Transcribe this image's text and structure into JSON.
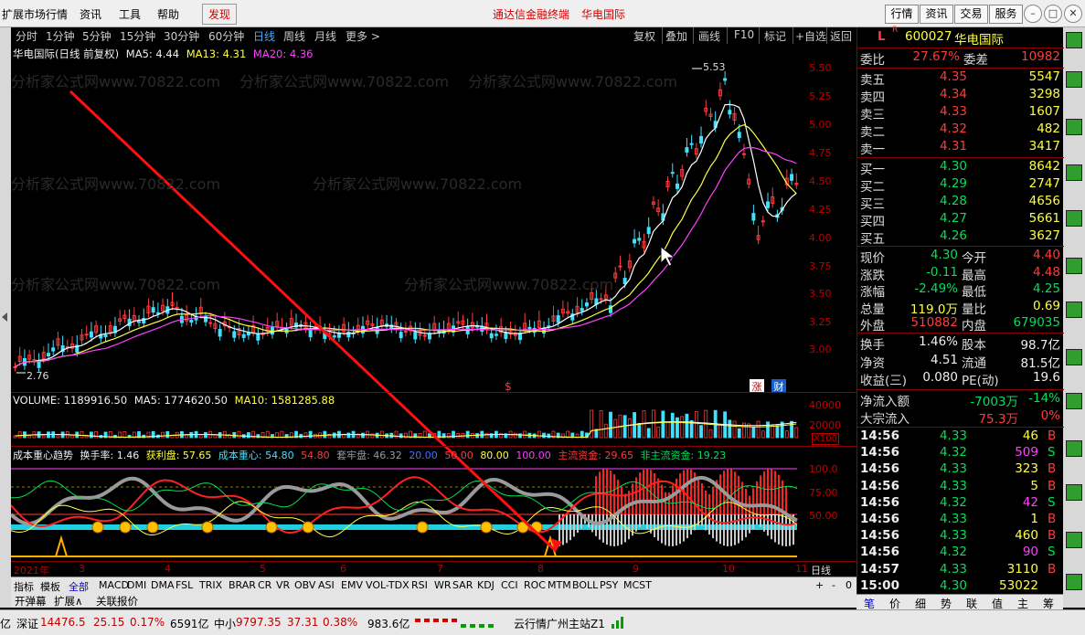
{
  "menu": {
    "items": [
      "扩展市场行情",
      "资讯",
      "工具",
      "帮助",
      "发现"
    ],
    "promo1": "通达信金融终端",
    "promo2": "华电国际",
    "tabs": [
      "行情",
      "资讯",
      "交易",
      "服务"
    ]
  },
  "periods": {
    "items": [
      "分时",
      "1分钟",
      "5分钟",
      "15分钟",
      "30分钟",
      "60分钟",
      "日线",
      "周线",
      "月线",
      "更多 >"
    ],
    "active": "日线",
    "tools": [
      "复权",
      "叠加",
      "画线",
      "F10",
      "标记",
      "+自选",
      "返回"
    ]
  },
  "main_chart": {
    "legend_title": "华电国际(日线 前复权)",
    "ma5": "MA5: 4.44",
    "ma13": "MA13: 4.31",
    "ma20": "MA20: 4.36",
    "high_label": "5.53",
    "low_label": "2.76",
    "watermark": "分析家公式网www.70822.com",
    "y_ticks": [
      "5.50",
      "5.25",
      "5.00",
      "4.75",
      "4.50",
      "4.25",
      "4.00",
      "3.75",
      "3.50",
      "3.25",
      "3.00"
    ],
    "badge_zhang": "涨",
    "badge_cai": "财",
    "dollar": "$"
  },
  "volume": {
    "label": "VOLUME: 1189916.50",
    "ma5": "MA5: 1774620.50",
    "ma10": "MA10: 1581285.88",
    "y_ticks": [
      "40000",
      "20000"
    ],
    "unit": "X100"
  },
  "indicator": {
    "title": "成本重心趋势",
    "turnover": "换手率: 1.46",
    "profit": "获利盘: 57.65",
    "center": "成本重心: 54.80",
    "v1": "54.80",
    "trap": "套牢盘: 46.32",
    "lv20": "20.00",
    "lv50": "50.00",
    "lv80": "80.00",
    "lv100": "100.00",
    "main_fund": "主流资金: 29.65",
    "non_main": "非主流资金: 19.23",
    "y_ticks": [
      "100.0",
      "75.00",
      "50.00"
    ]
  },
  "x_axis": {
    "labels": [
      "2021年",
      "3",
      "4",
      "5",
      "6",
      "7",
      "8",
      "9",
      "10",
      "11"
    ],
    "period_label": "日线"
  },
  "indicator_tabs": [
    "指标",
    "模板",
    "全部",
    "MACD",
    "DMI",
    "DMA",
    "FSL",
    "TRIX",
    "BRAR",
    "CR",
    "VR",
    "OBV",
    "ASI",
    "EMV",
    "VOL-TDX",
    "RSI",
    "WR",
    "SAR",
    "KDJ",
    "CCI",
    "ROC",
    "MTM",
    "BOLL",
    "PSY",
    "MCST"
  ],
  "subbar": [
    "开弹幕",
    "扩展∧",
    "关联报价"
  ],
  "quote": {
    "code": "600027",
    "name": "华电国际",
    "weibi_label": "委比",
    "weibi": "27.67%",
    "weicha_label": "委差",
    "weicha": "10982",
    "sell": [
      {
        "label": "卖五",
        "price": "4.35",
        "vol": "5547"
      },
      {
        "label": "卖四",
        "price": "4.34",
        "vol": "3298"
      },
      {
        "label": "卖三",
        "price": "4.33",
        "vol": "1607"
      },
      {
        "label": "卖二",
        "price": "4.32",
        "vol": "482"
      },
      {
        "label": "卖一",
        "price": "4.31",
        "vol": "3417"
      }
    ],
    "buy": [
      {
        "label": "买一",
        "price": "4.30",
        "vol": "8642"
      },
      {
        "label": "买二",
        "price": "4.29",
        "vol": "2747"
      },
      {
        "label": "买三",
        "price": "4.28",
        "vol": "4656"
      },
      {
        "label": "买四",
        "price": "4.27",
        "vol": "5661"
      },
      {
        "label": "买五",
        "price": "4.26",
        "vol": "3627"
      }
    ],
    "stats": [
      {
        "l1": "现价",
        "v1": "4.30",
        "l2": "今开",
        "v2": "4.40"
      },
      {
        "l1": "涨跌",
        "v1": "-0.11",
        "l2": "最高",
        "v2": "4.48"
      },
      {
        "l1": "涨幅",
        "v1": "-2.49%",
        "l2": "最低",
        "v2": "4.25"
      },
      {
        "l1": "总量",
        "v1": "119.0万",
        "l2": "量比",
        "v2": "0.69"
      },
      {
        "l1": "外盘",
        "v1": "510882",
        "l2": "内盘",
        "v2": "679035"
      }
    ],
    "stats2": [
      {
        "l1": "换手",
        "v1": "1.46%",
        "l2": "股本",
        "v2": "98.7亿"
      },
      {
        "l1": "净资",
        "v1": "4.51",
        "l2": "流通",
        "v2": "81.5亿"
      },
      {
        "l1": "收益(三)",
        "v1": "0.080",
        "l2": "PE(动)",
        "v2": "19.6"
      }
    ],
    "netflow_label": "净流入额",
    "netflow": "-7003万",
    "netflow_pct": "-14%",
    "big_label": "大宗流入",
    "big": "75.3万",
    "big_pct": "0%",
    "ticks": [
      {
        "t": "14:56",
        "p": "4.33",
        "v": "46",
        "s": "B"
      },
      {
        "t": "14:56",
        "p": "4.32",
        "v": "509",
        "s": "S"
      },
      {
        "t": "14:56",
        "p": "4.33",
        "v": "323",
        "s": "B"
      },
      {
        "t": "14:56",
        "p": "4.33",
        "v": "5",
        "s": "B"
      },
      {
        "t": "14:56",
        "p": "4.32",
        "v": "42",
        "s": "S"
      },
      {
        "t": "14:56",
        "p": "4.33",
        "v": "1",
        "s": "B"
      },
      {
        "t": "14:56",
        "p": "4.33",
        "v": "460",
        "s": "B"
      },
      {
        "t": "14:56",
        "p": "4.32",
        "v": "90",
        "s": "S"
      },
      {
        "t": "14:57",
        "p": "4.33",
        "v": "3110",
        "s": "B"
      },
      {
        "t": "15:00",
        "p": "4.30",
        "v": "53022",
        "s": ""
      }
    ],
    "tabs": [
      "笔",
      "价",
      "细",
      "势",
      "联",
      "值",
      "主",
      "筹"
    ]
  },
  "bottom": {
    "yi": "亿",
    "sz_label": "深证",
    "sz_val": "14476.5",
    "sz_chg": "25.15",
    "sz_pct": "0.17%",
    "sz_amt": "6591亿",
    "zx_label": "中小",
    "zx_val": "9797.35",
    "zx_chg": "37.31",
    "zx_pct": "0.38%",
    "zx_amt": "983.6亿",
    "server": "云行情广州主站Z1"
  }
}
